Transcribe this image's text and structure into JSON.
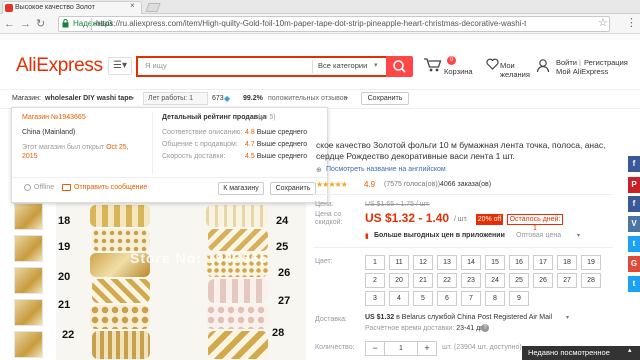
{
  "browser": {
    "tab_title": "Высокое качество Золот",
    "tab_close": "×",
    "secure_label": "Надежный",
    "url": "https://ru.aliexpress.com/item/High-quilty-Gold-foil-10m-paper-tape-dot-strip-pineapple-heart-christmas-decorative-washi-tape-"
  },
  "header": {
    "logo": "AliExpress",
    "search_placeholder": "Я ищу",
    "all_categories": "Все категории",
    "cart_count": "0",
    "cart_label": "Корзина",
    "wishlist_label_1": "Мои",
    "wishlist_label_2": "желания",
    "signin": "Войти",
    "register": "Регистрация",
    "my_aliexpress": "Мой AliExpress"
  },
  "store_bar": {
    "label": "Магазин:",
    "name": "wholesaler DIY washi tape",
    "years": "Лет работы: 1",
    "feedback_count": "673",
    "positive_pct": "99.2%",
    "positive_label": "положительных отзывов",
    "save_button": "Сохранить"
  },
  "store_popup": {
    "store_number": "Магазин №1943665",
    "country": "China (Mainland)",
    "opened_text": "Этот магазин был открыт",
    "opened_date": "Oct 25, 2015",
    "rating_title": "Детальный рейтинг продавца",
    "rating_count": "(из 5)",
    "rows": [
      {
        "label": "Соответствие описанию:",
        "score": "4.8",
        "note": "Выше среднего"
      },
      {
        "label": "Общение с продавцом:",
        "score": "4.7",
        "note": "Выше среднего"
      },
      {
        "label": "Скорость доставки:",
        "score": "4.5",
        "note": "Выше среднего"
      }
    ],
    "offline": "Offline",
    "send_message": "Отправить сообщение",
    "to_store": "К магазину",
    "save": "Сохранить"
  },
  "image": {
    "watermark": "Store No: 1943665",
    "numbers_left": [
      "18",
      "19",
      "20",
      "21",
      "22"
    ],
    "numbers_right": [
      "24",
      "25",
      "26",
      "27",
      "28"
    ]
  },
  "product": {
    "title": "ское качество Золотой фольги 10 м бумажная лента точка, полоса, анас, сердце Рождество декоративные васи лента 1 шт.",
    "translate_link": "Посмотреть название на английском",
    "stars": "★★★★★",
    "rating": "4.9",
    "votes": "(7575 голоса(ов))",
    "orders": "4066 заказа(ов)",
    "old_price_label": "Цена:",
    "old_price": "US $1.65 - 1.75 / шт.",
    "discount_label_1": "Цена со",
    "discount_label_2": "скидкой:",
    "new_price": "US $1.32 - 1.40",
    "price_unit": "/ шт.",
    "discount_badge": "20% off",
    "days_left": "Осталось дней: 1",
    "app_offer": "Больше выгодных цен в приложении",
    "wholesale": "Оптовая цена",
    "color_label": "Цвет:",
    "colors": [
      "1",
      "11",
      "12",
      "13",
      "14",
      "15",
      "16",
      "17",
      "18",
      "19",
      "2",
      "20",
      "21",
      "22",
      "23",
      "24",
      "25",
      "26",
      "27",
      "28",
      "3",
      "4",
      "5",
      "6",
      "7",
      "8",
      "9"
    ],
    "shipping_label": "Доставка:",
    "shipping_price": "US $1.32",
    "shipping_text": "в Belarus службой China Post Registered Air Mail",
    "delivery_label": "Расчётное время доставки:",
    "delivery_days": "23-41 дн.",
    "qty_label": "Количество:",
    "qty_minus": "−",
    "qty_value": "1",
    "qty_plus": "+",
    "qty_note": "шт. (23904 шт. доступно)"
  },
  "social": [
    "f",
    "P",
    "f",
    "V",
    "t",
    "G",
    "t"
  ],
  "recent_label": "Недавно посмотренное"
}
